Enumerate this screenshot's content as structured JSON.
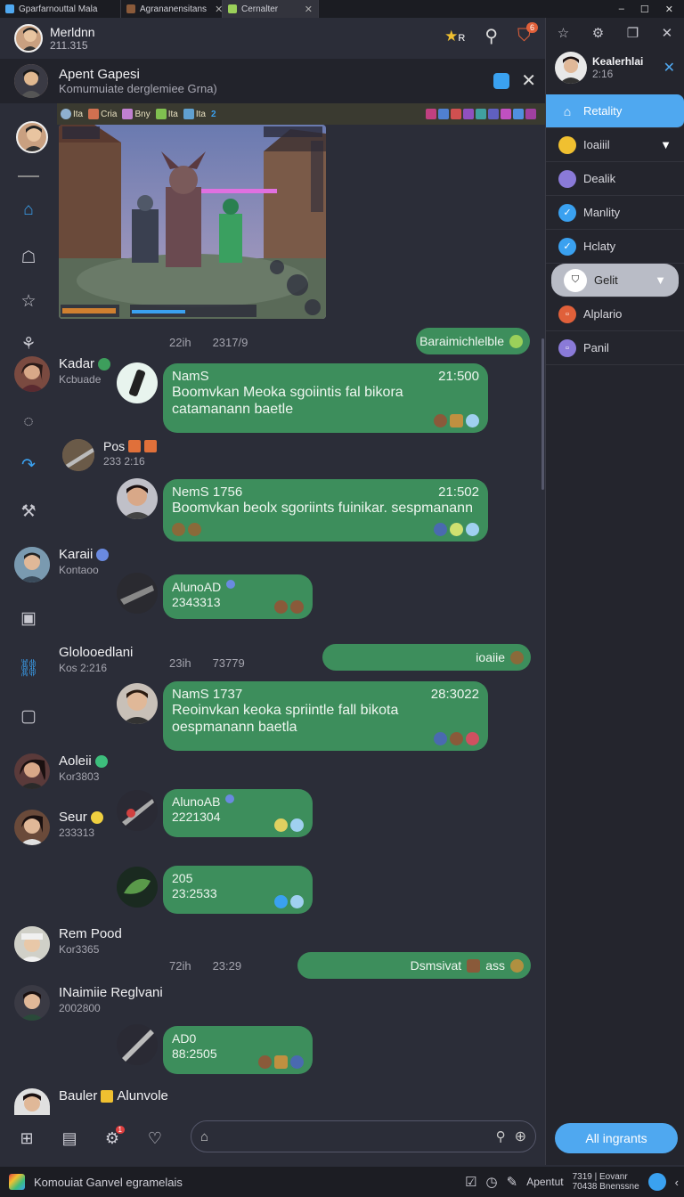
{
  "tabs": [
    {
      "label": "Gparfarnouttal Mala",
      "color": "#4fa8f0"
    },
    {
      "label": "Agrananensitans",
      "color": "#8a5a3a"
    },
    {
      "label": "Cernalter",
      "color": "#9bd05a"
    }
  ],
  "window_controls": [
    "–",
    "☐",
    "✕"
  ],
  "header": {
    "title": "Merldnn",
    "subtitle": "211.315",
    "notif_count": "6",
    "star_badge": "R"
  },
  "subheader": {
    "title": "Apent Gapesi",
    "subtitle": "Komumuiate derglemiee Grna)"
  },
  "strip": {
    "chips": [
      "Ita",
      "Cria",
      "Bny",
      "Ita",
      "Ita",
      "2"
    ]
  },
  "timestamps": [
    {
      "a": "22ih",
      "b": "2317/9"
    },
    {
      "a": "23ih",
      "b": "73779"
    },
    {
      "a": "72ih",
      "b": "23:29"
    }
  ],
  "users": [
    {
      "name": "Kadar",
      "sub": "Kcbuade"
    },
    {
      "name": "Pos",
      "sub": "233 2:16"
    },
    {
      "name": "Karaii",
      "sub": "Kontaoo"
    },
    {
      "name": "Glolooedlani",
      "sub": "Kos 2:216"
    },
    {
      "name": "Aoleii",
      "sub": "Kor3803"
    },
    {
      "name": "Seur",
      "sub": "233313"
    },
    {
      "name": "Rem Pood",
      "sub": "Kor3365"
    },
    {
      "name": "INaimiie Reglvani",
      "sub": "2002800"
    },
    {
      "name": "Bauler",
      "suffix": "Alunvole"
    }
  ],
  "pills": [
    {
      "text": "Baraimichlelble"
    },
    {
      "text": "ioaiie"
    },
    {
      "text": "Dsmsivat",
      "text2": "ass"
    }
  ],
  "bubbles": [
    {
      "name": "NamS",
      "time": "21:500",
      "body": "Boomvkan Meoka sgoiintis fal bikora catamanann baetle"
    },
    {
      "name": "NemS 1756",
      "time": "21:502",
      "body": "Boomvkan beolx sgoriints fuinikar. sespmanann"
    },
    {
      "name": "AlunoAD",
      "body": "2343313"
    },
    {
      "name": "NamS 1737",
      "time": "28:3022",
      "body": "Reoinvkan keoka spriintle fall bikota oespmanann baetla"
    },
    {
      "name": "AlunoAB",
      "body": "2221304"
    },
    {
      "name": "205",
      "body": "23:2533"
    },
    {
      "name": "AD0",
      "body": "88:2505"
    }
  ],
  "right_panel": {
    "user": {
      "name": "Kealerhlai",
      "sub": "2:16"
    },
    "items": [
      {
        "label": "Retality",
        "color": "#ffffff",
        "icon": "home-icon"
      },
      {
        "label": "Ioaiiil",
        "color": "#f0c030",
        "icon": "smile-icon"
      },
      {
        "label": "Dealik",
        "color": "#8a7ad8",
        "icon": "chat-icon"
      },
      {
        "label": "Manlity",
        "color": "#3aa1f0",
        "icon": "check-icon"
      },
      {
        "label": "Hclaty",
        "color": "#3aa1f0",
        "icon": "check-icon"
      },
      {
        "label": "Gelit",
        "color": "#333333",
        "icon": "shield-icon"
      },
      {
        "label": "Alplario",
        "color": "#e0603a",
        "icon": "square-icon"
      },
      {
        "label": "Panil",
        "color": "#8a7ad8",
        "icon": "square-icon"
      }
    ]
  },
  "bottom": {
    "all_button": "All ingrants",
    "gear_badge": "1"
  },
  "taskbar": {
    "app": "Komouiat Ganvel egramelais",
    "right_label": "Apentut",
    "clock_line1": "7319 | Eovanr",
    "clock_line2": "70438 Bnenssne"
  }
}
